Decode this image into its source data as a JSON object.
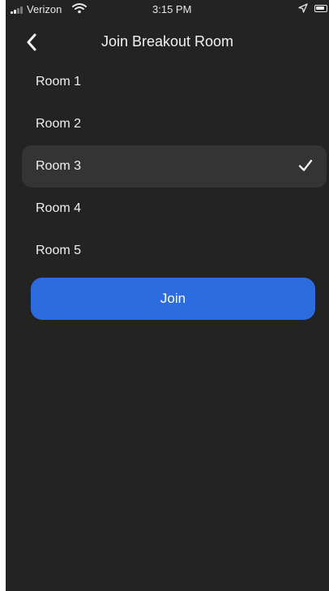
{
  "status_bar": {
    "carrier": "Verizon",
    "time": "3:15 PM"
  },
  "header": {
    "title": "Join Breakout Room"
  },
  "rooms": [
    {
      "label": "Room 1",
      "selected": false
    },
    {
      "label": "Room 2",
      "selected": false
    },
    {
      "label": "Room 3",
      "selected": true
    },
    {
      "label": "Room 4",
      "selected": false
    },
    {
      "label": "Room 5",
      "selected": false
    }
  ],
  "join_button": {
    "label": "Join"
  },
  "colors": {
    "background": "#232323",
    "selected_row": "#343434",
    "accent": "#2d6cdf",
    "text": "#f0f0f0"
  },
  "icons": [
    "signal-icon",
    "wifi-icon",
    "location-arrow-icon",
    "battery-icon",
    "back-chevron-icon",
    "checkmark-icon"
  ]
}
